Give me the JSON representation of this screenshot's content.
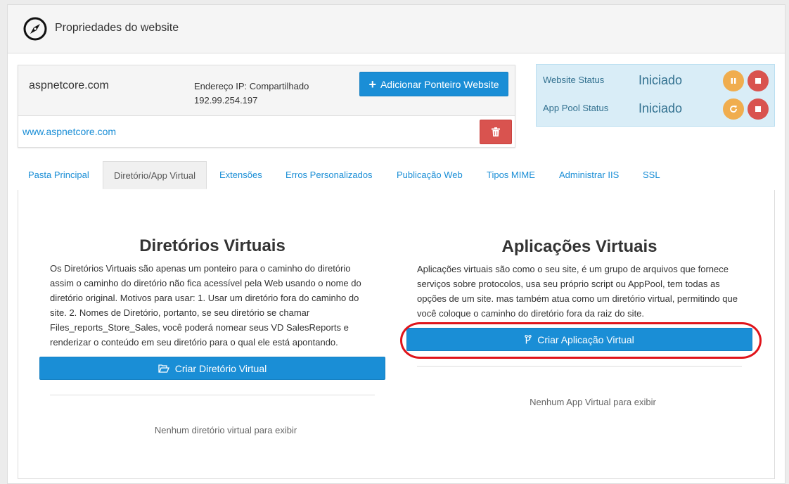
{
  "header": {
    "title": "Propriedades do website",
    "icon": "compass-icon"
  },
  "site": {
    "domain": "aspnetcore.com",
    "ip_label": "Endereço IP: Compartilhado",
    "ip_value": "192.99.254.197",
    "add_pointer_label": "Adicionar Ponteiro Website",
    "link": "www.aspnetcore.com"
  },
  "status": {
    "website_label": "Website Status",
    "website_value": "Iniciado",
    "apppool_label": "App Pool Status",
    "apppool_value": "Iniciado"
  },
  "tabs": [
    {
      "label": "Pasta Principal"
    },
    {
      "label": "Diretório/App Virtual",
      "active": true
    },
    {
      "label": "Extensões"
    },
    {
      "label": "Erros Personalizados"
    },
    {
      "label": "Publicação Web"
    },
    {
      "label": "Tipos MIME"
    },
    {
      "label": "Administrar IIS"
    },
    {
      "label": "SSL"
    }
  ],
  "virtual_dirs": {
    "title": "Diretórios Virtuais",
    "description": "Os Diretórios Virtuais são apenas um ponteiro para o caminho do diretório assim o caminho do diretório não fica acessível pela Web usando o nome do diretório original. Motivos para usar: 1. Usar um diretório fora do caminho do site. 2. Nomes de Diretório, portanto, se seu diretório se chamar Files_reports_Store_Sales, você poderá nomear seus VD SalesReports e renderizar o conteúdo em seu diretório para o qual ele está apontando.",
    "button_label": "Criar Diretório Virtual",
    "empty_message": "Nenhum diretório virtual para exibir"
  },
  "virtual_apps": {
    "title": "Aplicações Virtuais",
    "description": "Aplicações virtuais são como o seu site, é um grupo de arquivos que fornece serviços sobre protocolos, usa seu próprio script ou AppPool, tem todas as opções de um site. mas também atua como um diretório virtual, permitindo que você coloque o caminho do diretório fora da raiz do site.",
    "button_label": "Criar Aplicação Virtual",
    "empty_message": "Nenhum App Virtual para exibir"
  },
  "colors": {
    "accent": "#1a8ed6",
    "danger": "#d9534f",
    "warning": "#f0ad4e",
    "info_bg": "#d9edf7",
    "highlight": "#e0141b"
  }
}
